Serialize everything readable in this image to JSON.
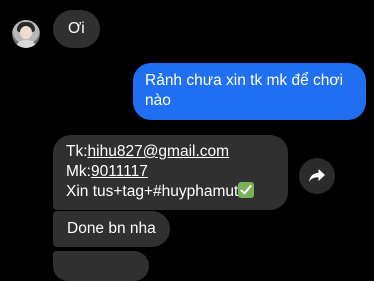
{
  "conversation": {
    "messages": [
      {
        "direction": "incoming",
        "text": "Ơi"
      },
      {
        "direction": "outgoing",
        "text": "Rảnh chưa xin tk mk để chơi nào"
      },
      {
        "direction": "incoming",
        "lines": {
          "tk_prefix": "Tk:",
          "tk_value": "hihu827@gmail.com",
          "mk_prefix": "Mk:",
          "mk_value": "9011117",
          "note": "Xin tus+tag+#huyphamut"
        }
      },
      {
        "direction": "incoming",
        "text": "Done bn nha"
      }
    ]
  },
  "icons": {
    "avatar": "contact-avatar",
    "share": "share-arrow-icon",
    "check": "check-mark-emoji"
  },
  "colors": {
    "background": "#000000",
    "incoming_bubble": "#303030",
    "outgoing_bubble": "#1f6ff0"
  }
}
